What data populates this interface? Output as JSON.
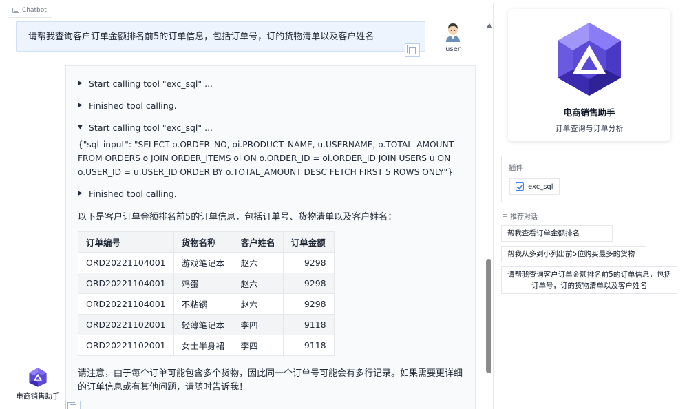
{
  "chatbot_tab": {
    "label": "Chatbot"
  },
  "user_message": {
    "text": "请帮我查询客户订单金额排名前5的订单信息，包括订单号，订的货物清单以及客户姓名",
    "sender": "user"
  },
  "bot_message": {
    "tool_calls": [
      {
        "state": "collapsed",
        "label": "Start calling tool \"exc_sql\" ..."
      },
      {
        "state": "collapsed",
        "label": "Finished tool calling."
      },
      {
        "state": "expanded",
        "label": "Start calling tool \"exc_sql\" ..."
      },
      {
        "state": "collapsed",
        "label": "Finished tool calling."
      }
    ],
    "sql_input": "{\"sql_input\": \"SELECT o.ORDER_NO, oi.PRODUCT_NAME, u.USERNAME, o.TOTAL_AMOUNT FROM ORDERS o JOIN ORDER_ITEMS oi ON o.ORDER_ID = oi.ORDER_ID JOIN USERS u ON o.USER_ID = u.USER_ID ORDER BY o.TOTAL_AMOUNT DESC FETCH FIRST 5 ROWS ONLY\"}",
    "intro": "以下是客户订单金额排名前5的订单信息，包括订单号、货物清单以及客户姓名：",
    "table": {
      "headers": [
        "订单编号",
        "货物名称",
        "客户姓名",
        "订单金额"
      ],
      "rows": [
        [
          "ORD20221104001",
          "游戏笔记本",
          "赵六",
          "9298"
        ],
        [
          "ORD20221104001",
          "鸡蛋",
          "赵六",
          "9298"
        ],
        [
          "ORD20221104001",
          "不粘锅",
          "赵六",
          "9298"
        ],
        [
          "ORD20221102001",
          "轻薄笔记本",
          "李四",
          "9118"
        ],
        [
          "ORD20221102001",
          "女士半身裙",
          "李四",
          "9118"
        ]
      ]
    },
    "note": "请注意，由于每个订单可能包含多个货物，因此同一个订单号可能会有多行记录。如果需要更详细的订单信息或有其他问题，请随时告诉我！",
    "sender": "电商销售助手"
  },
  "agent": {
    "name": "电商销售助手",
    "description": "订单查询与订单分析",
    "logo_colors": {
      "light": "#7b6cf0",
      "mid": "#5b4ad6",
      "dark": "#3b2bb0"
    }
  },
  "plugins": {
    "title": "插件",
    "items": [
      {
        "label": "exc_sql",
        "checked": true
      }
    ]
  },
  "suggestions": {
    "title": "推荐对话",
    "items": [
      "帮我查看订单金额排名",
      "帮我从多到小列出前5位购买最多的货物",
      "请帮我查询客户订单金额排名前5的订单信息，包括订单号，订的货物清单以及客户姓名"
    ]
  },
  "colors": {
    "accent": "#3b82f6",
    "user_bubble": "#eef4fd",
    "bot_bubble": "#f9fafb"
  }
}
